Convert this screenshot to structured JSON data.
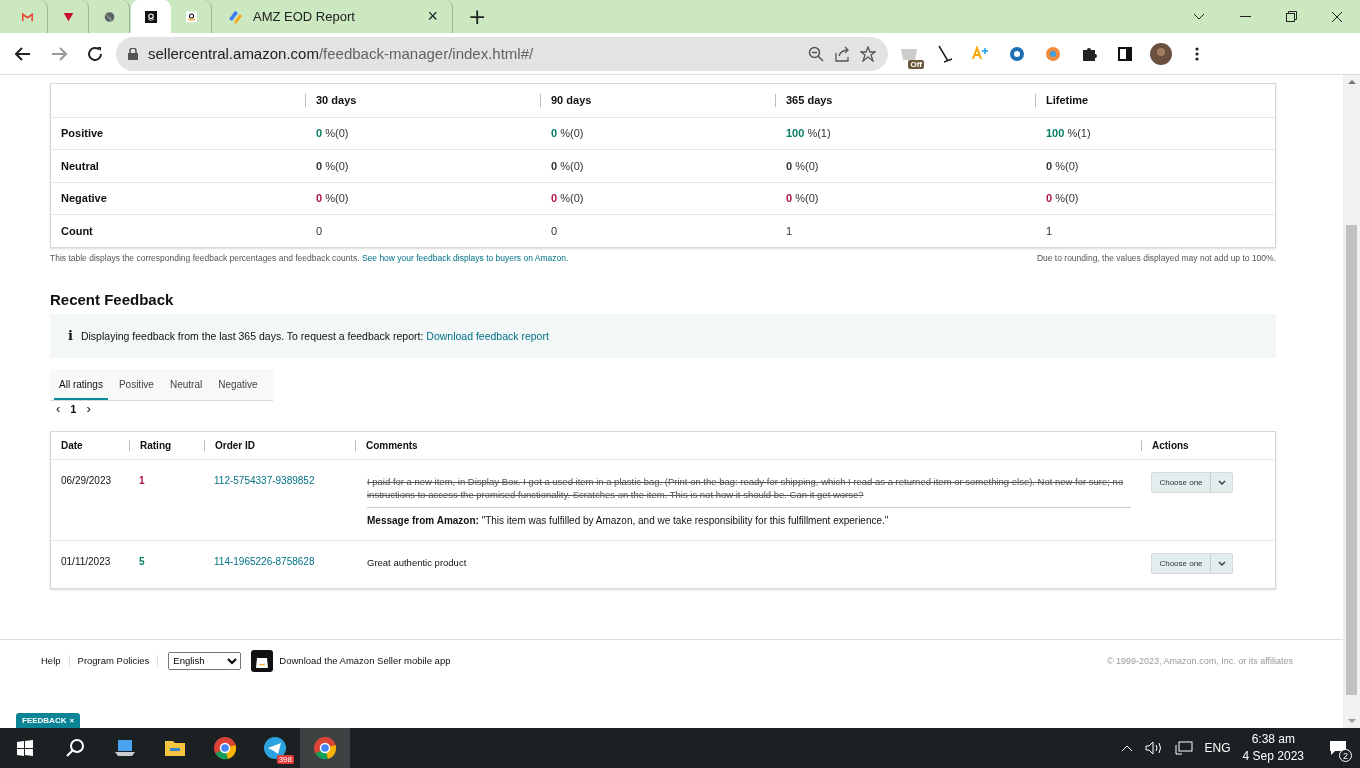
{
  "browser": {
    "tabs": [
      {
        "kind": "gmail",
        "selected": false
      },
      {
        "kind": "shield",
        "selected": false
      },
      {
        "kind": "globe",
        "selected": false
      },
      {
        "kind": "amazon-dark",
        "selected": true
      },
      {
        "kind": "amazon-light",
        "selected": false
      },
      {
        "kind": "app",
        "label": "AMZ EOD Report",
        "close": "×",
        "selected": false
      }
    ],
    "new_tab": "+",
    "url_host": "sellercentral.amazon.com",
    "url_path": "/feedback-manager/index.html#/",
    "extension_badge": "Off"
  },
  "ratings_table": {
    "columns": [
      "30 days",
      "90 days",
      "365 days",
      "Lifetime"
    ],
    "rows": [
      {
        "label": "Positive",
        "kind": "positive",
        "cells": [
          {
            "value": "0",
            "suffix": " %(0)"
          },
          {
            "value": "0",
            "suffix": " %(0)"
          },
          {
            "value": "100",
            "suffix": " %(1)"
          },
          {
            "value": "100",
            "suffix": " %(1)"
          }
        ]
      },
      {
        "label": "Neutral",
        "kind": "neutral",
        "cells": [
          {
            "value": "0",
            "suffix": " %(0)"
          },
          {
            "value": "0",
            "suffix": " %(0)"
          },
          {
            "value": "0",
            "suffix": " %(0)"
          },
          {
            "value": "0",
            "suffix": " %(0)"
          }
        ]
      },
      {
        "label": "Negative",
        "kind": "negative",
        "cells": [
          {
            "value": "0",
            "suffix": " %(0)"
          },
          {
            "value": "0",
            "suffix": " %(0)"
          },
          {
            "value": "0",
            "suffix": " %(0)"
          },
          {
            "value": "0",
            "suffix": " %(0)"
          }
        ]
      },
      {
        "label": "Count",
        "kind": "count",
        "cells": [
          {
            "value": "0"
          },
          {
            "value": "0"
          },
          {
            "value": "1"
          },
          {
            "value": "1"
          }
        ]
      }
    ],
    "note": "This table displays the corresponding feedback percentages and feedback counts.",
    "note_link": "See how your feedback displays to buyers on Amazon.",
    "rounding_note": "Due to rounding, the values displayed may not add up to 100%."
  },
  "recent": {
    "title": "Recent Feedback",
    "info_icon": "i",
    "info": "Displaying feedback from the last 365 days. To request a feedback report:",
    "info_link": "Download feedback report",
    "tabs": [
      {
        "label": "All ratings",
        "selected": true
      },
      {
        "label": "Positive",
        "selected": false
      },
      {
        "label": "Neutral",
        "selected": false
      },
      {
        "label": "Negative",
        "selected": false
      }
    ],
    "pager": {
      "prev": "‹",
      "page": "1",
      "next": "›"
    },
    "columns": [
      "Date",
      "Rating",
      "Order ID",
      "Comments",
      "Actions"
    ],
    "rows": [
      {
        "date": "06/29/2023",
        "rating": "1",
        "color": "#b0124a",
        "order_id": "112-5754337-9389852",
        "comment": "I paid for a new item, in Display Box. I got a used item in a plastic bag. (Print on the bag: ready for shipping, which I read as a returned item or something else). Not new for sure; no instructions to access the promised functionality. Scratches on the item. This is not how it should be. Can it get worse?",
        "struck": true,
        "message": "**Message from Amazon:** \"This item was fulfilled by Amazon, and we take responsibility for this fulfillment experience.\"",
        "action": "Choose one"
      },
      {
        "date": "01/11/2023",
        "rating": "5",
        "color": "#067d62",
        "order_id": "114-1965226-8758628",
        "comment": "Great authentic product",
        "struck": false,
        "action": "Choose one"
      }
    ]
  },
  "footer": {
    "links": [
      "Help",
      "Program Policies"
    ],
    "language": "English",
    "app_link": "Download the Amazon Seller mobile app",
    "copyright": "© 1999-2023, Amazon.com, Inc. or its affiliates",
    "feedback_tab": "FEEDBACK",
    "feedback_close": "×"
  },
  "taskbar": {
    "telegram_badge": "398",
    "language": "ENG",
    "time": "6:38 am",
    "date": "4 Sep 2023",
    "notifications": "2"
  }
}
